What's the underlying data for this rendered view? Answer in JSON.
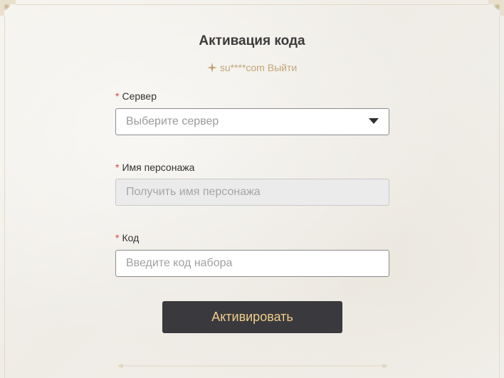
{
  "page": {
    "title": "Активация кода",
    "account": {
      "masked_email": "su****com",
      "logout_label": "Выйти",
      "icon": "sparkle-icon"
    }
  },
  "form": {
    "required_mark": "*",
    "server": {
      "label": "Сервер",
      "placeholder": "Выберите сервер",
      "icon": "chevron-down-icon"
    },
    "character": {
      "label": "Имя персонажа",
      "placeholder": "Получить имя персонажа"
    },
    "code": {
      "label": "Код",
      "placeholder": "Введите код набора"
    },
    "submit_label": "Активировать"
  },
  "colors": {
    "accent_gold": "#c0a676",
    "button_bg": "#3a3a3e",
    "button_text": "#f0cd8a",
    "required": "#e23d3d"
  }
}
